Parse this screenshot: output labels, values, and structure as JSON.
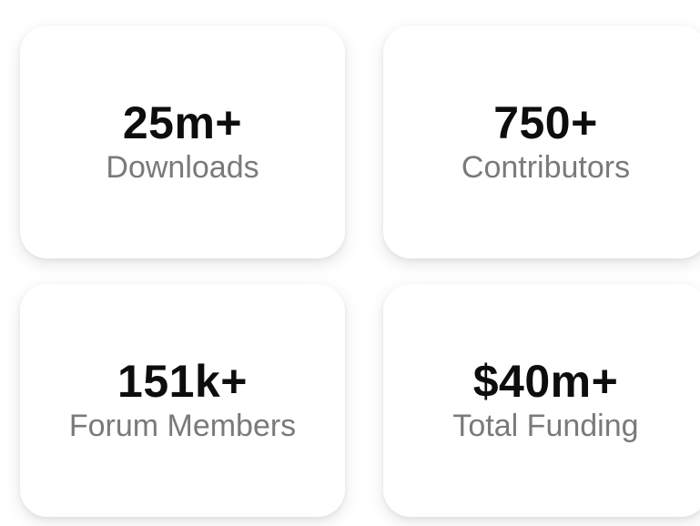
{
  "stats": [
    {
      "value": "25m+",
      "label": "Downloads"
    },
    {
      "value": "750+",
      "label": "Contributors"
    },
    {
      "value": "151k+",
      "label": "Forum Members"
    },
    {
      "value": "$40m+",
      "label": "Total Funding"
    }
  ],
  "colors": {
    "value_text": "#0d0d0d",
    "label_text": "#7a7a7a",
    "card_background": "#ffffff"
  }
}
